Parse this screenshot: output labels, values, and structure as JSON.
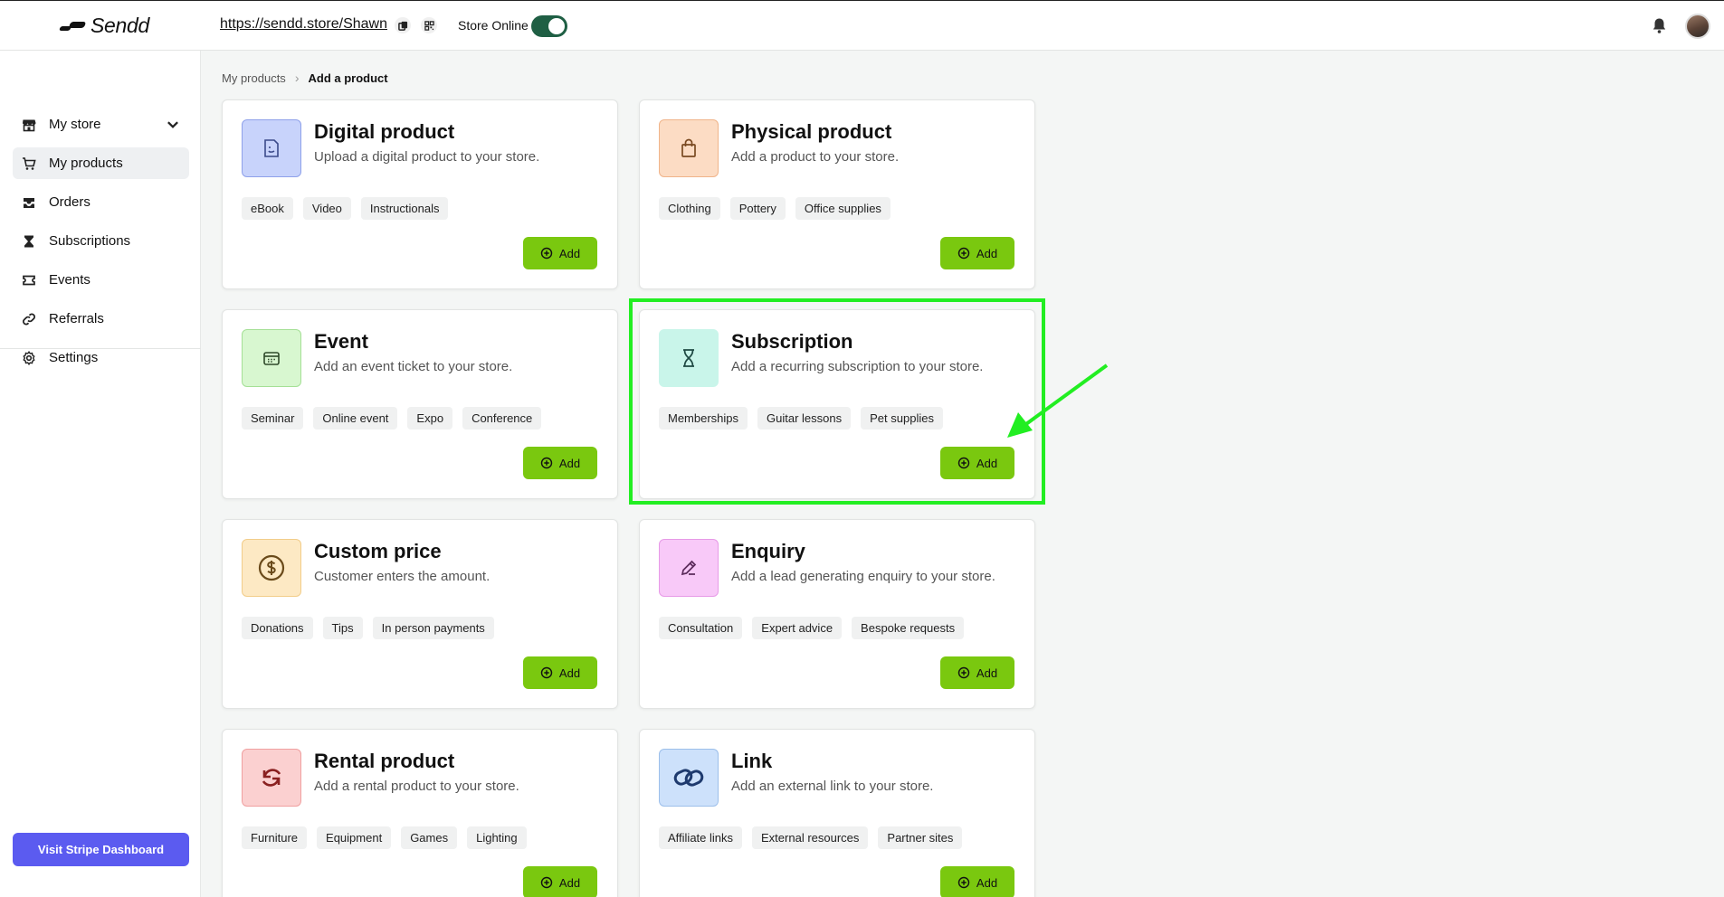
{
  "header": {
    "logo_text": "Sendd",
    "store_url": "https://sendd.store/Shawn",
    "store_status_label": "Store Online",
    "store_online": true
  },
  "sidebar": {
    "items": [
      {
        "label": "My store",
        "icon": "storefront-icon",
        "has_chevron": true
      },
      {
        "label": "My products",
        "icon": "cart-icon",
        "active": true
      },
      {
        "label": "Orders",
        "icon": "inbox-icon"
      },
      {
        "label": "Subscriptions",
        "icon": "hourglass-icon"
      },
      {
        "label": "Events",
        "icon": "ticket-icon"
      },
      {
        "label": "Referrals",
        "icon": "link-icon"
      },
      {
        "label": "Settings",
        "icon": "gear-icon"
      }
    ],
    "stripe_button": "Visit Stripe Dashboard"
  },
  "breadcrumb": {
    "parent": "My products",
    "current": "Add a product"
  },
  "cards": [
    {
      "title": "Digital product",
      "description": "Upload a digital product to your store.",
      "tags": [
        "eBook",
        "Video",
        "Instructionals"
      ],
      "add_label": "Add",
      "icon": "file-icon",
      "icon_bg": "#c8d3fb",
      "icon_border": "#8fa1ea",
      "icon_color": "#3b4a8a"
    },
    {
      "title": "Physical product",
      "description": "Add a product to your store.",
      "tags": [
        "Clothing",
        "Pottery",
        "Office supplies"
      ],
      "add_label": "Add",
      "icon": "shopping-bag-icon",
      "icon_bg": "#fcdcc4",
      "icon_border": "#f0b48a",
      "icon_color": "#7a4a22"
    },
    {
      "title": "Event",
      "description": "Add an event ticket to your store.",
      "tags": [
        "Seminar",
        "Online event",
        "Expo",
        "Conference"
      ],
      "add_label": "Add",
      "icon": "ticket-icon",
      "icon_bg": "#d8f7d0",
      "icon_border": "#a5e096",
      "icon_color": "#2f4a2a"
    },
    {
      "title": "Subscription",
      "description": "Add a recurring subscription to your store.",
      "tags": [
        "Memberships",
        "Guitar lessons",
        "Pet supplies"
      ],
      "add_label": "Add",
      "icon": "hourglass-icon",
      "icon_bg": "#c9f5ea",
      "icon_border": "#c9f5ea",
      "icon_color": "#1f4a44"
    },
    {
      "title": "Custom price",
      "description": "Customer enters the amount.",
      "tags": [
        "Donations",
        "Tips",
        "In person payments"
      ],
      "add_label": "Add",
      "icon": "coin-icon",
      "icon_bg": "#fde9c4",
      "icon_border": "#f2cd8a",
      "icon_color": "#6a4a1a"
    },
    {
      "title": "Enquiry",
      "description": "Add a lead generating enquiry to your store.",
      "tags": [
        "Consultation",
        "Expert advice",
        "Bespoke requests"
      ],
      "add_label": "Add",
      "icon": "pencil-icon",
      "icon_bg": "#f8c9f8",
      "icon_border": "#e79ae7",
      "icon_color": "#5a2a5a"
    },
    {
      "title": "Rental product",
      "description": "Add a rental product to your store.",
      "tags": [
        "Furniture",
        "Equipment",
        "Games",
        "Lighting"
      ],
      "add_label": "Add",
      "icon": "refresh-icon",
      "icon_bg": "#fbd0d0",
      "icon_border": "#f0a0a0",
      "icon_color": "#8a2020"
    },
    {
      "title": "Link",
      "description": "Add an external link to your store.",
      "tags": [
        "Affiliate links",
        "External resources",
        "Partner sites"
      ],
      "add_label": "Add",
      "icon": "link-icon",
      "icon_bg": "#cde1fb",
      "icon_border": "#9cbfea",
      "icon_color": "#1e3a6e"
    }
  ],
  "colors": {
    "accent_green": "#7ac80f",
    "highlight": "#22ee22",
    "stripe_button": "#5b5bf0",
    "toggle_on": "#1f5f44"
  }
}
